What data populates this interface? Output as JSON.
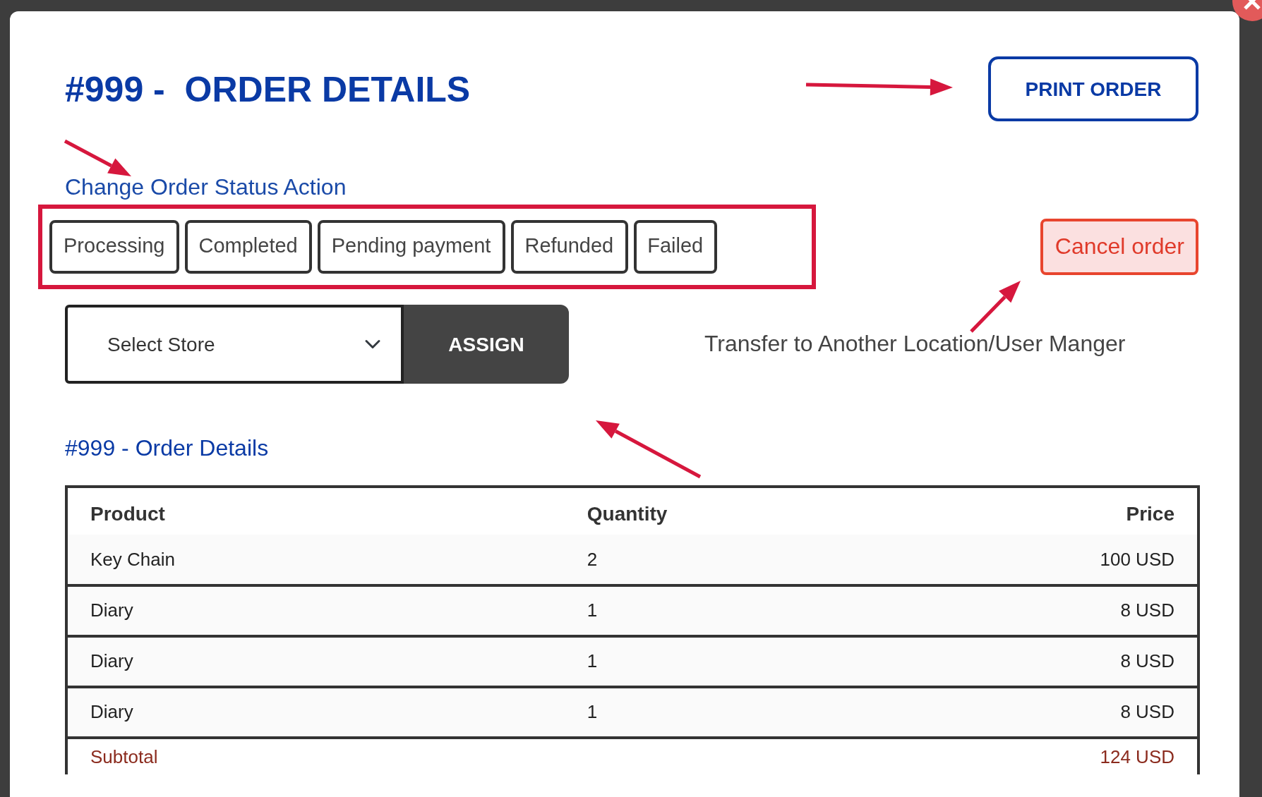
{
  "modal": {
    "title": "#999 -  ORDER DETAILS",
    "print_button": "PRINT ORDER",
    "status_label": "Change Order Status Action",
    "status_buttons": [
      "Processing",
      "Completed",
      "Pending payment",
      "Refunded",
      "Failed"
    ],
    "cancel_button": "Cancel order",
    "store_select": {
      "placeholder": "Select Store"
    },
    "assign_button": "ASSIGN",
    "transfer_note": "Transfer to Another Location/User Manger",
    "section_link": "#999 - Order Details",
    "table": {
      "columns": [
        "Product",
        "Quantity",
        "Price"
      ],
      "rows": [
        [
          "Key Chain",
          "2",
          "100 USD"
        ],
        [
          "Diary",
          "1",
          "8 USD"
        ],
        [
          "Diary",
          "1",
          "8 USD"
        ],
        [
          "Diary",
          "1",
          "8 USD"
        ]
      ],
      "footer": [
        "Subtotal",
        "124 USD"
      ]
    }
  }
}
